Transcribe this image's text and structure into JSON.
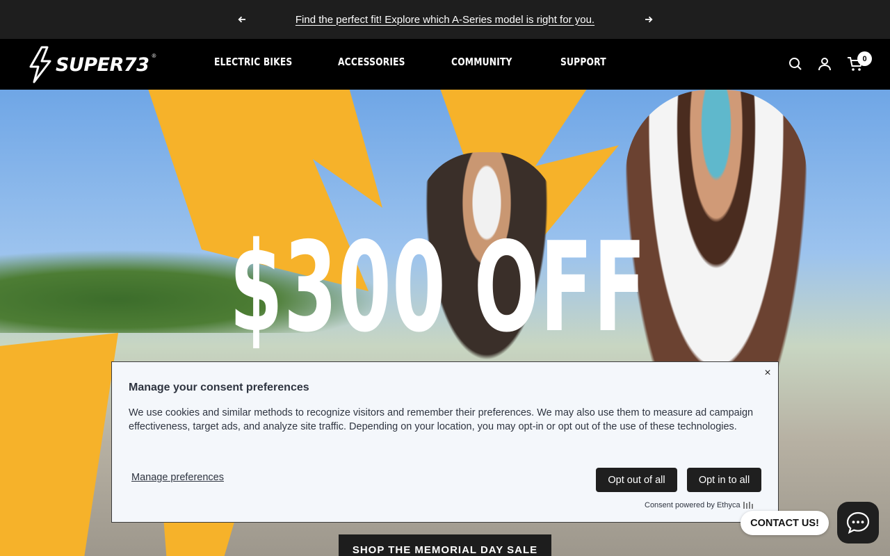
{
  "announcement": {
    "message": "Find the perfect fit! Explore which A-Series model is right for you.",
    "prev_icon": "arrow-left-icon",
    "next_icon": "arrow-right-icon"
  },
  "header": {
    "logo_text": "SUPER73",
    "logo_mark": "®",
    "nav": [
      "ELECTRIC BIKES",
      "ACCESSORIES",
      "COMMUNITY",
      "SUPPORT"
    ],
    "icons": [
      "search-icon",
      "account-icon",
      "cart-icon"
    ],
    "cart_count": "0"
  },
  "hero": {
    "headline": "$300 OFF",
    "cta": "SHOP THE MEMORIAL DAY SALE",
    "accent_color": "#f6b22a"
  },
  "consent": {
    "title": "Manage your consent preferences",
    "body": "We use cookies and similar methods to recognize visitors and remember their preferences. We may also use them to measure ad campaign effectiveness, target ads, and analyze site traffic. Depending on your location, you may opt-in or opt out of the use of these technologies.",
    "close": "×",
    "manage_link": "Manage preferences",
    "opt_out": "Opt out of all",
    "opt_in": "Opt in to all",
    "powered_by": "Consent powered by Ethyca"
  },
  "chat": {
    "contact_label": "CONTACT US!",
    "icon": "chat-bubble-icon"
  }
}
